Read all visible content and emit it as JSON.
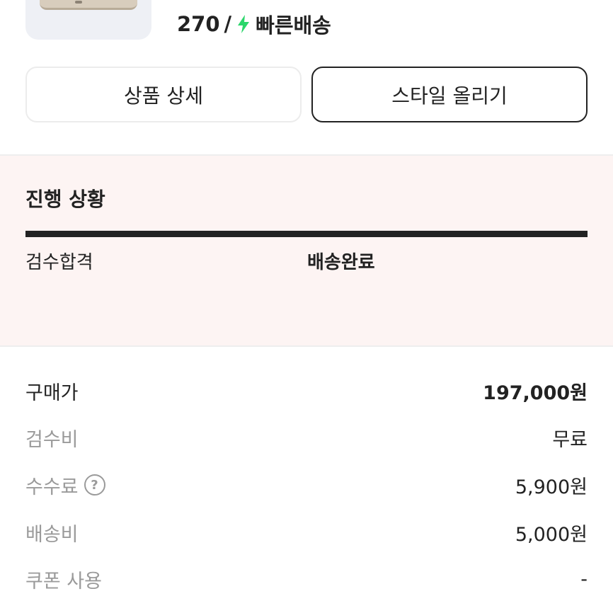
{
  "product": {
    "size": "270",
    "separator": "/",
    "shipping_label": "빠른배송",
    "shipping_color": "#2bd66b"
  },
  "buttons": {
    "detail_label": "상품 상세",
    "style_label": "스타일 올리기"
  },
  "progress": {
    "title": "진행 상황",
    "completed_fraction": 1.0,
    "steps": [
      {
        "label": "검수합격"
      },
      {
        "label": "배송완료"
      }
    ]
  },
  "price": {
    "rows": [
      {
        "label": "구매가",
        "value": "197,000원"
      },
      {
        "label": "검수비",
        "value": "무료"
      },
      {
        "label": "수수료",
        "value": "5,900원",
        "help_icon": "?"
      },
      {
        "label": "배송비",
        "value": "5,000원"
      },
      {
        "label": "쿠폰 사용",
        "value": "-"
      }
    ]
  },
  "colors": {
    "progress_bg": "#fdf4f3",
    "accent_dark": "#222222",
    "muted_text": "#9a9a9a"
  }
}
